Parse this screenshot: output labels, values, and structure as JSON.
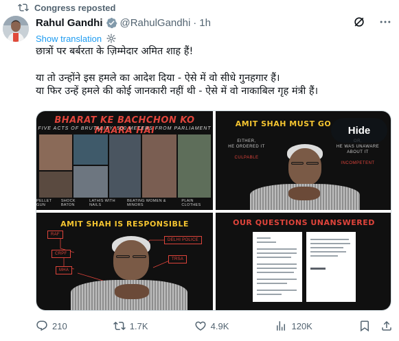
{
  "repost": {
    "text": "Congress reposted"
  },
  "author": {
    "name": "Rahul Gandhi",
    "handle": "@RahulGandhi",
    "separator": "·",
    "time": "1h"
  },
  "translation": {
    "label": "Show translation"
  },
  "tweet": {
    "line1": "छात्रों पर बर्बरता के ज़िम्मेदार अमित शाह हैं!",
    "line2": "या तो उन्होंने इस हमले का आदेश दिया - ऐसे में वो सीधे गुनहगार हैं।",
    "line3": "या फिर उन्हें हमले की कोई जानकारी नहीं थी - ऐसे में वो नाकाबिल गृह मंत्री हैं।"
  },
  "media": {
    "tile1": {
      "title": "BHARAT KE BACHCHON KO MAARA HAI",
      "subtitle": "FIVE ACTS OF BRUTALITY, 500 METERS FROM PARLIAMENT",
      "captions": [
        "PELLET GUN",
        "SHOCK BATON",
        "LATHIS WITH NAILS",
        "BEATING WOMEN & MINORS",
        "PLAIN CLOTHES"
      ]
    },
    "tile2": {
      "title": "AMIT SHAH MUST GO",
      "left_line1": "EITHER,",
      "left_line2": "HE ORDERED IT",
      "left_red": "CULPABLE",
      "right_line1": "OR,",
      "right_line2": "HE WAS UNAWARE ABOUT IT",
      "right_red": "INCOMPETENT",
      "hide_label": "Hide"
    },
    "tile3": {
      "title": "AMIT SHAH IS RESPONSIBLE",
      "boxes": [
        "RAF",
        "CRPF",
        "MHA",
        "DELHI POLICE",
        "TRSA"
      ]
    },
    "tile4": {
      "title": "OUR QUESTIONS UNANSWERED"
    }
  },
  "actions": {
    "replies": "210",
    "reposts": "1.7K",
    "likes": "4.9K",
    "views": "120K"
  },
  "colors": {
    "accent": "#1d9bf0",
    "muted": "#536471",
    "repost_green": "#536471",
    "title_red": "#e0443b",
    "title_yellow": "#f4c430"
  }
}
